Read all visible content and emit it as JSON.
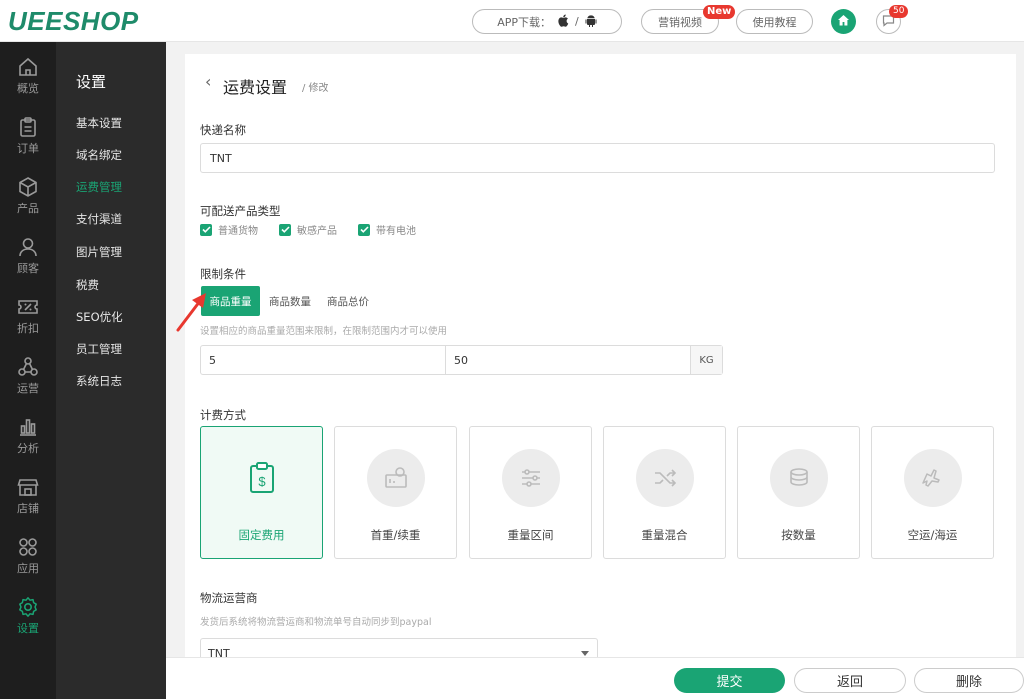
{
  "topbar": {
    "logo": "UEESHOP",
    "app_download": "APP下载：",
    "app_sep": "/",
    "marketing_video": "营销视频",
    "new_badge": "New",
    "tutorial": "使用教程",
    "message_count": "50"
  },
  "iconbar": {
    "items": [
      {
        "label": "概览",
        "icon": "home-outline-icon"
      },
      {
        "label": "订单",
        "icon": "clipboard-icon"
      },
      {
        "label": "产品",
        "icon": "cube-icon"
      },
      {
        "label": "顾客",
        "icon": "user-icon"
      },
      {
        "label": "折扣",
        "icon": "percent-ticket-icon"
      },
      {
        "label": "运营",
        "icon": "network-icon"
      },
      {
        "label": "分析",
        "icon": "bar-chart-icon"
      },
      {
        "label": "店铺",
        "icon": "store-icon"
      },
      {
        "label": "应用",
        "icon": "apps-grid-icon"
      },
      {
        "label": "设置",
        "icon": "gear-icon"
      }
    ],
    "active_index": 9,
    "active_color": "#1aa474"
  },
  "submenu": {
    "title": "设置",
    "items": [
      "基本设置",
      "域名绑定",
      "运费管理",
      "支付渠道",
      "图片管理",
      "税费",
      "SEO优化",
      "员工管理",
      "系统日志"
    ],
    "active_index": 2
  },
  "page": {
    "title": "运费设置",
    "subtitle": "/ 修改"
  },
  "form": {
    "courier_name_label": "快递名称",
    "courier_name_value": "TNT",
    "product_types_label": "可配送产品类型",
    "product_types": [
      {
        "label": "普通货物",
        "checked": true
      },
      {
        "label": "敏感产品",
        "checked": true
      },
      {
        "label": "带有电池",
        "checked": true
      }
    ],
    "limit_label": "限制条件",
    "limit_tabs": [
      "商品重量",
      "商品数量",
      "商品总价"
    ],
    "limit_active_index": 0,
    "limit_hint": "设置相应的商品重量范围来限制，在限制范围内才可以使用",
    "range_min": "5",
    "range_max": "50",
    "range_unit": "KG",
    "billing_label": "计费方式",
    "billing_options": [
      {
        "label": "固定费用",
        "icon": "dollar-clipboard-icon"
      },
      {
        "label": "首重/续重",
        "icon": "scale-icon"
      },
      {
        "label": "重量区间",
        "icon": "sliders-icon"
      },
      {
        "label": "重量混合",
        "icon": "shuffle-icon"
      },
      {
        "label": "按数量",
        "icon": "stack-icon"
      },
      {
        "label": "空运/海运",
        "icon": "plane-ship-icon"
      }
    ],
    "billing_active_index": 0,
    "carrier_label": "物流运营商",
    "carrier_hint": "发货后系统将物流营运商和物流单号自动同步到paypal",
    "carrier_value": "TNT"
  },
  "actions": {
    "submit": "提交",
    "back": "返回",
    "delete": "删除"
  },
  "colors": {
    "accent": "#1aa474",
    "badge": "#e8382f"
  }
}
